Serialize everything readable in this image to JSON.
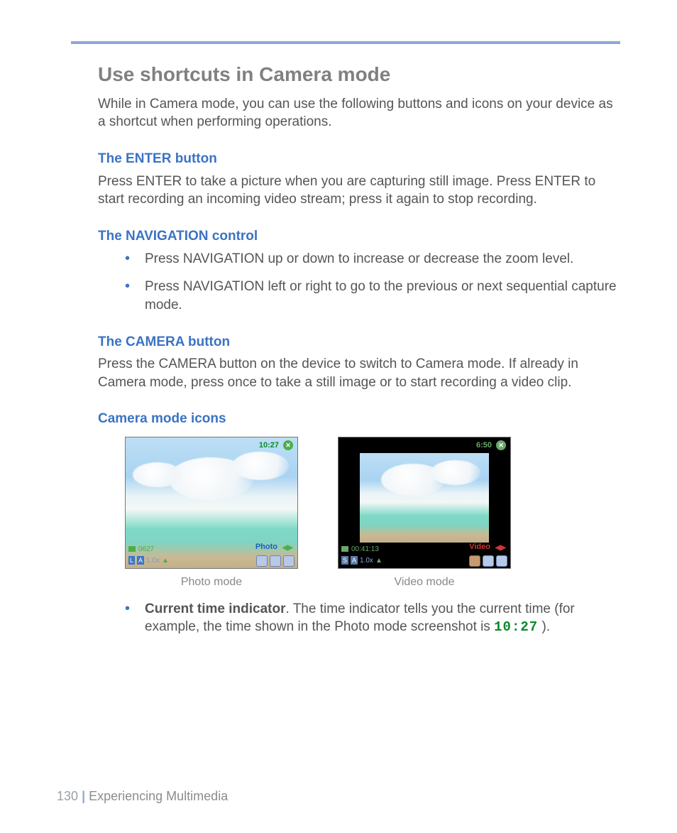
{
  "title": "Use shortcuts in Camera mode",
  "intro": "While in Camera mode, you can use the following buttons and icons on your device as a shortcut when performing operations.",
  "sections": {
    "enter": {
      "heading": "The ENTER button",
      "body": "Press ENTER to take a picture when you are capturing still image. Press ENTER to start recording an incoming video stream; press it again to stop recording."
    },
    "nav": {
      "heading": "The NAVIGATION control",
      "bullets": [
        "Press NAVIGATION up or down to increase or decrease the zoom level.",
        "Press NAVIGATION left or right to go to the previous or next sequential capture mode."
      ]
    },
    "camera": {
      "heading": "The CAMERA button",
      "body": "Press the CAMERA button on the device to switch to Camera mode. If already in Camera mode, press once to take a still image or to start recording a video clip."
    },
    "icons": {
      "heading": "Camera mode icons"
    }
  },
  "figures": {
    "photo": {
      "caption": "Photo mode",
      "time": "10:27",
      "mode_label": "Photo",
      "counter": "0627",
      "bottom_row": "L A 1.0x ▲"
    },
    "video": {
      "caption": "Video mode",
      "time": "6:50",
      "mode_label": "Video",
      "counter": "00:41:13",
      "bottom_row": "S A 1.0x ▲"
    }
  },
  "current_time": {
    "bullet_strong": "Current time indicator",
    "bullet_rest_1": ". The time indicator tells you the current time (for example, the time shown in the Photo mode screenshot is ",
    "time_value": "10:27",
    "bullet_rest_2": " )."
  },
  "footer": {
    "page_number": "130",
    "chapter": "Experiencing Multimedia"
  }
}
